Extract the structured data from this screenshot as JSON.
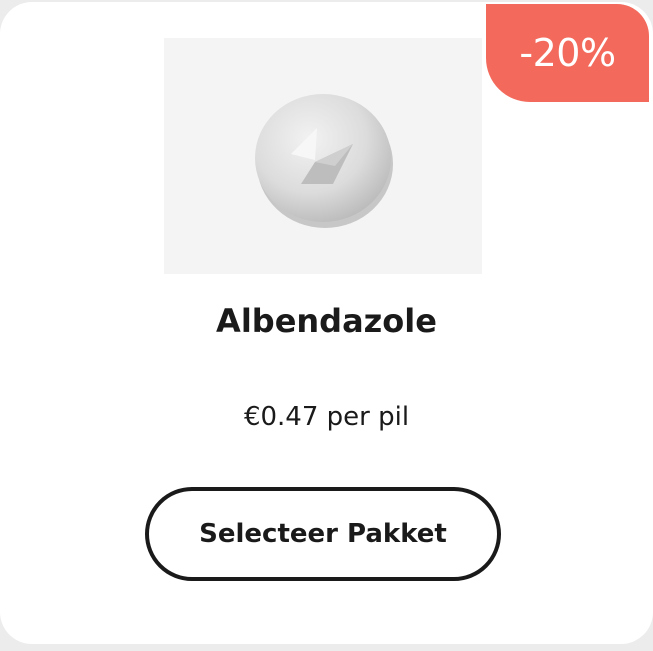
{
  "product": {
    "discount_badge": "-20%",
    "name": "Albendazole",
    "price": "€0.47 per pil",
    "cta_label": "Selecteer Pakket",
    "image_icon": "pill-icon"
  },
  "colors": {
    "badge_bg": "#f36a5c",
    "text": "#1a1a1a",
    "card_bg": "#ffffff"
  }
}
